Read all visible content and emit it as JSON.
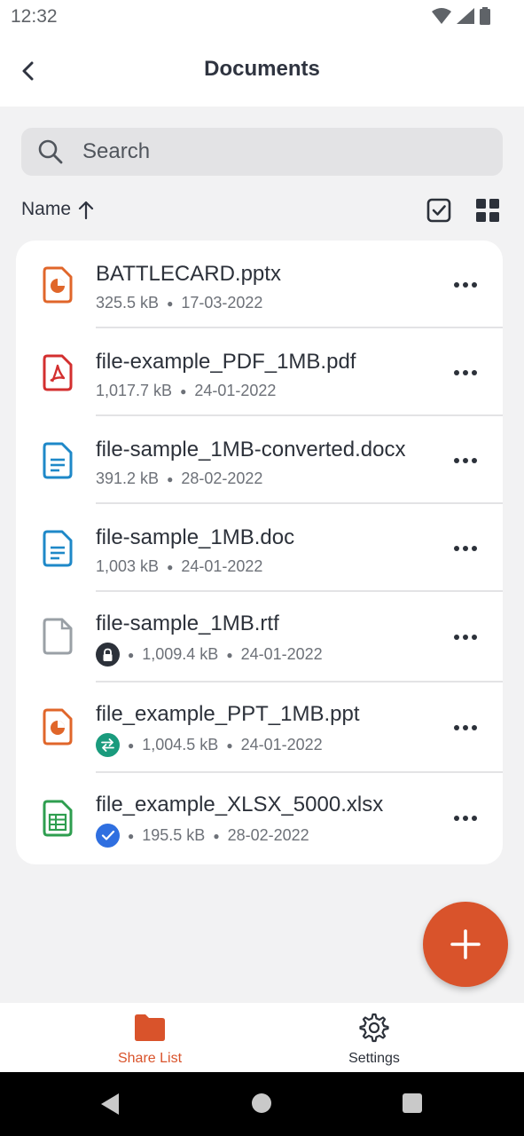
{
  "status_bar": {
    "time": "12:32"
  },
  "header": {
    "title": "Documents"
  },
  "search": {
    "placeholder": "Search"
  },
  "sort": {
    "label": "Name"
  },
  "files": [
    {
      "name": "BATTLECARD.pptx",
      "size": "325.5 kB",
      "date": "17-03-2022",
      "type": "presentation",
      "badge": ""
    },
    {
      "name": "file-example_PDF_1MB.pdf",
      "size": "1,017.7 kB",
      "date": "24-01-2022",
      "type": "pdf",
      "badge": ""
    },
    {
      "name": "file-sample_1MB-converted.docx",
      "size": "391.2 kB",
      "date": "28-02-2022",
      "type": "document",
      "badge": ""
    },
    {
      "name": "file-sample_1MB.doc",
      "size": "1,003 kB",
      "date": "24-01-2022",
      "type": "document",
      "badge": ""
    },
    {
      "name": "file-sample_1MB.rtf",
      "size": "1,009.4 kB",
      "date": "24-01-2022",
      "type": "generic",
      "badge": "lock"
    },
    {
      "name": "file_example_PPT_1MB.ppt",
      "size": "1,004.5 kB",
      "date": "24-01-2022",
      "type": "presentation",
      "badge": "sync"
    },
    {
      "name": "file_example_XLSX_5000.xlsx",
      "size": "195.5 kB",
      "date": "28-02-2022",
      "type": "spreadsheet",
      "badge": "check"
    }
  ],
  "bottom_nav": {
    "share_list": "Share List",
    "settings": "Settings"
  },
  "colors": {
    "accent": "#d9532b",
    "pdf": "#d32f2f",
    "document": "#1e88c8",
    "spreadsheet": "#2e9e4f",
    "sync_badge": "#1a9b7d",
    "check_badge": "#2f6fe0",
    "lock_badge": "#2c313a"
  }
}
